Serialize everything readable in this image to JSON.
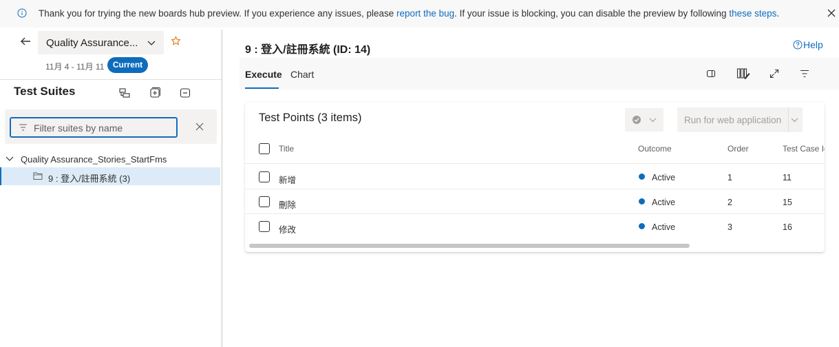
{
  "banner": {
    "text_before": "Thank you for trying the new boards hub preview. If you experience any issues, please ",
    "link1": "report the bug",
    "text_middle": ". If your issue is blocking, you can disable the preview by following ",
    "link2": "these steps",
    "text_after": ".",
    "close_icon": "close-icon"
  },
  "sidebar": {
    "project_name": "Quality Assurance...",
    "iteration": "11月 4 - 11月 11",
    "iteration_badge": "Current",
    "title": "Test Suites",
    "filter_placeholder": "Filter suites by name",
    "tree": {
      "root": "Quality Assurance_Stories_StartFms",
      "child": "9 : 登入/註冊系統 (3)"
    }
  },
  "main": {
    "title": "9 : 登入/註冊系統 (ID: 14)",
    "help": "Help",
    "tabs": [
      "Execute",
      "Chart"
    ],
    "active_tab": "Execute"
  },
  "test_points": {
    "title": "Test Points (3 items)",
    "run_button": "Run for web application",
    "columns": [
      "Title",
      "Outcome",
      "Order",
      "Test Case Id"
    ],
    "rows": [
      {
        "title": "新增",
        "outcome": "Active",
        "order": "1",
        "test_case_id": "11"
      },
      {
        "title": "刪除",
        "outcome": "Active",
        "order": "2",
        "test_case_id": "15"
      },
      {
        "title": "修改",
        "outcome": "Active",
        "order": "3",
        "test_case_id": "16"
      }
    ]
  },
  "colors": {
    "accent": "#0f6cbd",
    "active_dot": "#0f6cbd",
    "selected_row": "#dcebf7"
  }
}
